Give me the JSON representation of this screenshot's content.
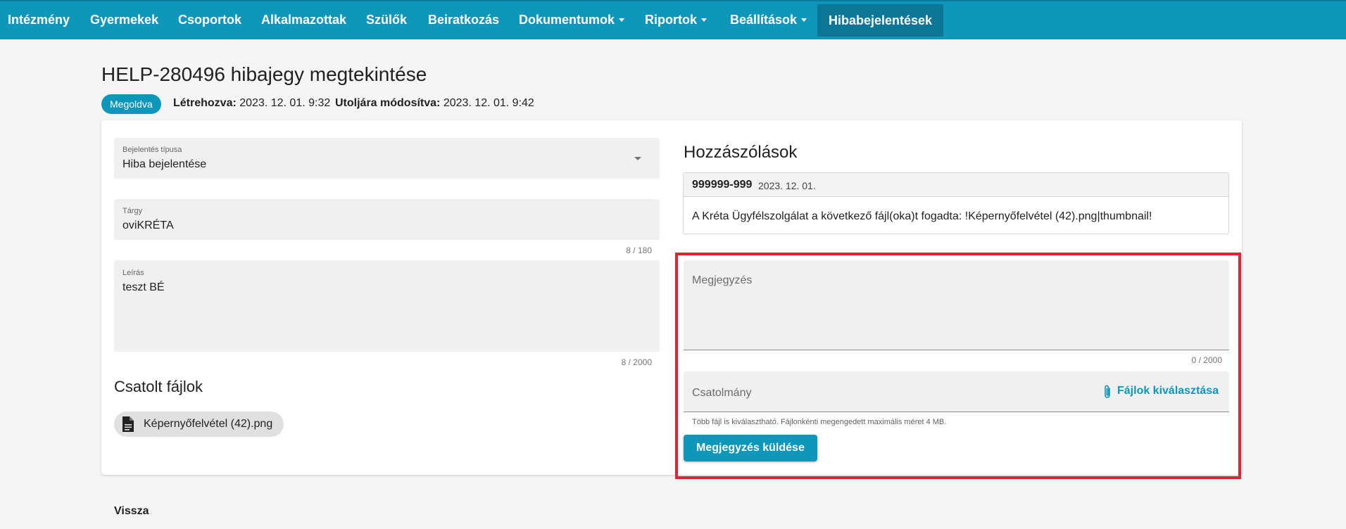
{
  "nav": {
    "items": [
      {
        "label": "Intézmény",
        "dropdown": false
      },
      {
        "label": "Gyermekek",
        "dropdown": false
      },
      {
        "label": "Csoportok",
        "dropdown": false
      },
      {
        "label": "Alkalmazottak",
        "dropdown": false
      },
      {
        "label": "Szülők",
        "dropdown": false
      },
      {
        "label": "Beiratkozás",
        "dropdown": false
      },
      {
        "label": "Dokumentumok",
        "dropdown": true
      },
      {
        "label": "Riportok",
        "dropdown": true
      },
      {
        "label": "Beállítások",
        "dropdown": true
      },
      {
        "label": "Hibabejelentések",
        "dropdown": false,
        "active": true
      }
    ]
  },
  "header": {
    "title": "HELP-280496 hibajegy megtekintése",
    "status": "Megoldva",
    "created_label": "Létrehozva:",
    "created_value": "2023. 12. 01. 9:32",
    "modified_label": "Utoljára módosítva:",
    "modified_value": "2023. 12. 01. 9:42"
  },
  "form": {
    "type_label": "Bejelentés típusa",
    "type_value": "Hiba bejelentése",
    "subject_label": "Tárgy",
    "subject_value": "oviKRÉTA",
    "subject_counter": "8 / 180",
    "description_label": "Leírás",
    "description_value": "teszt BÉ",
    "description_counter": "8 / 2000"
  },
  "attachments": {
    "title": "Csatolt fájlok",
    "files": [
      "Képernyőfelvétel (42).png"
    ]
  },
  "comments": {
    "title": "Hozzászólások",
    "items": [
      {
        "author": "999999-999",
        "date": "2023. 12. 01.",
        "text": "A Kréta Ügyfélszolgálat a következő fájl(oka)t fogadta: !Képernyőfelvétel (42).png|thumbnail!"
      }
    ]
  },
  "new_comment": {
    "note_placeholder": "Megjegyzés",
    "note_counter": "0 / 2000",
    "attach_label": "Csatolmány",
    "choose_files": "Fájlok kiválasztása",
    "hint": "Több fájl is kiválasztható. Fájlonkénti megengedett maximális méret 4 MB.",
    "send_button": "Megjegyzés küldése"
  },
  "footer": {
    "back": "Vissza"
  },
  "colors": {
    "primary": "#0e97bb",
    "nav_active": "#0b7695",
    "highlight": "#e32232"
  }
}
